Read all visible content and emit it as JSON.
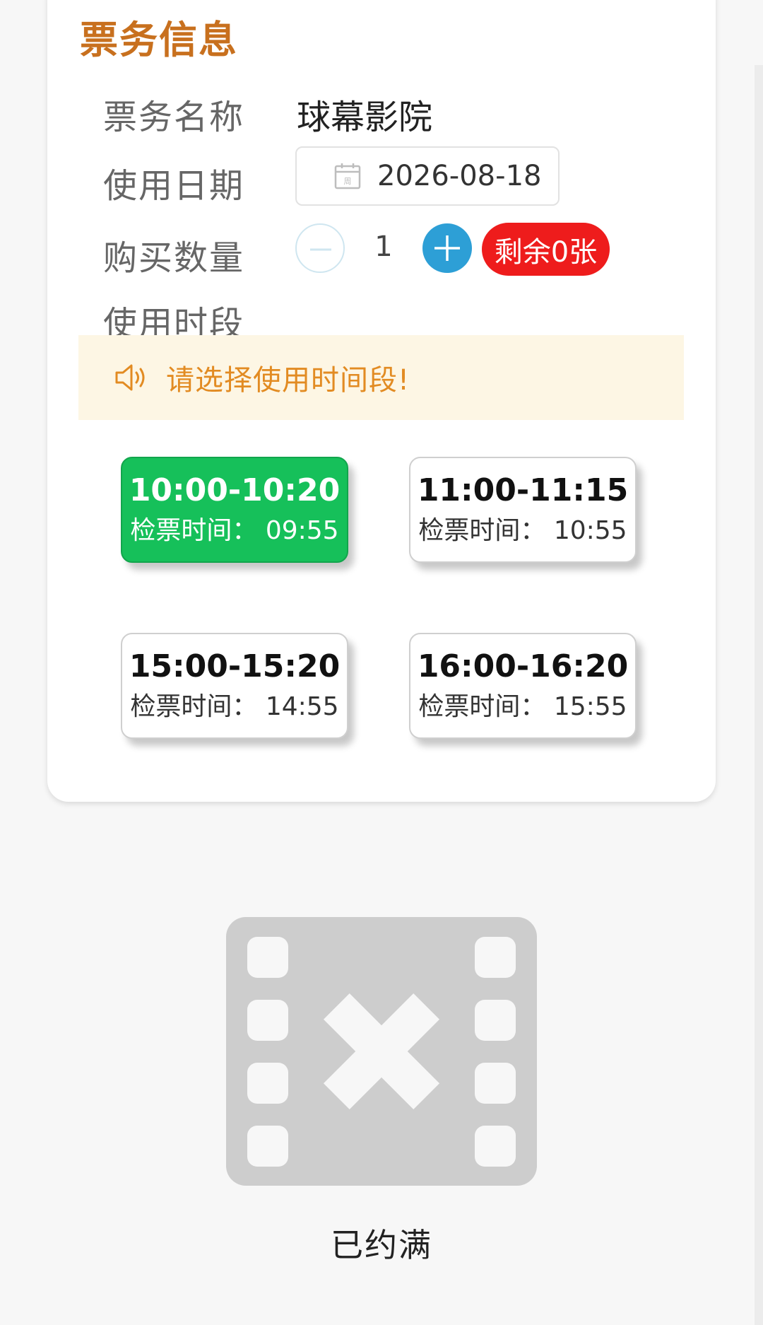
{
  "ticket_info": {
    "title": "票务信息",
    "name_label": "票务名称",
    "name_value": "球幕影院",
    "date_label": "使用日期",
    "date_value": "2026-08-18",
    "calendar_icon_text": "周",
    "quantity_label": "购买数量",
    "quantity_value": "1",
    "remaining_badge": "剩余0张",
    "period_label": "使用时段"
  },
  "notice": {
    "icon": "speaker-icon",
    "text": "请选择使用时间段!"
  },
  "time_slots": [
    {
      "time": "10:00-10:20",
      "check": "检票时间：  09:55",
      "selected": true
    },
    {
      "time": "11:00-11:15",
      "check": "检票时间：  10:55",
      "selected": false
    },
    {
      "time": "15:00-15:20",
      "check": "检票时间：  14:55",
      "selected": false
    },
    {
      "time": "16:00-16:20",
      "check": "检票时间：  15:55",
      "selected": false
    }
  ],
  "empty_state": {
    "icon": "film-unavailable-icon",
    "text": "已约满"
  },
  "colors": {
    "title": "#c8701e",
    "selected_slot": "#16c05a",
    "badge": "#ee1c1c",
    "plus_button": "#2d9fd6",
    "notice_bg": "#fdf6e4",
    "notice_text": "#e28b22"
  }
}
